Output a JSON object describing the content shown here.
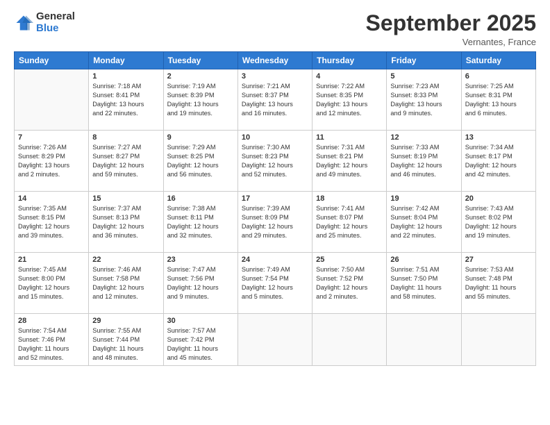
{
  "logo": {
    "general": "General",
    "blue": "Blue"
  },
  "header": {
    "title": "September 2025",
    "location": "Vernantes, France"
  },
  "weekdays": [
    "Sunday",
    "Monday",
    "Tuesday",
    "Wednesday",
    "Thursday",
    "Friday",
    "Saturday"
  ],
  "weeks": [
    [
      {
        "day": "",
        "info": ""
      },
      {
        "day": "1",
        "info": "Sunrise: 7:18 AM\nSunset: 8:41 PM\nDaylight: 13 hours\nand 22 minutes."
      },
      {
        "day": "2",
        "info": "Sunrise: 7:19 AM\nSunset: 8:39 PM\nDaylight: 13 hours\nand 19 minutes."
      },
      {
        "day": "3",
        "info": "Sunrise: 7:21 AM\nSunset: 8:37 PM\nDaylight: 13 hours\nand 16 minutes."
      },
      {
        "day": "4",
        "info": "Sunrise: 7:22 AM\nSunset: 8:35 PM\nDaylight: 13 hours\nand 12 minutes."
      },
      {
        "day": "5",
        "info": "Sunrise: 7:23 AM\nSunset: 8:33 PM\nDaylight: 13 hours\nand 9 minutes."
      },
      {
        "day": "6",
        "info": "Sunrise: 7:25 AM\nSunset: 8:31 PM\nDaylight: 13 hours\nand 6 minutes."
      }
    ],
    [
      {
        "day": "7",
        "info": "Sunrise: 7:26 AM\nSunset: 8:29 PM\nDaylight: 13 hours\nand 2 minutes."
      },
      {
        "day": "8",
        "info": "Sunrise: 7:27 AM\nSunset: 8:27 PM\nDaylight: 12 hours\nand 59 minutes."
      },
      {
        "day": "9",
        "info": "Sunrise: 7:29 AM\nSunset: 8:25 PM\nDaylight: 12 hours\nand 56 minutes."
      },
      {
        "day": "10",
        "info": "Sunrise: 7:30 AM\nSunset: 8:23 PM\nDaylight: 12 hours\nand 52 minutes."
      },
      {
        "day": "11",
        "info": "Sunrise: 7:31 AM\nSunset: 8:21 PM\nDaylight: 12 hours\nand 49 minutes."
      },
      {
        "day": "12",
        "info": "Sunrise: 7:33 AM\nSunset: 8:19 PM\nDaylight: 12 hours\nand 46 minutes."
      },
      {
        "day": "13",
        "info": "Sunrise: 7:34 AM\nSunset: 8:17 PM\nDaylight: 12 hours\nand 42 minutes."
      }
    ],
    [
      {
        "day": "14",
        "info": "Sunrise: 7:35 AM\nSunset: 8:15 PM\nDaylight: 12 hours\nand 39 minutes."
      },
      {
        "day": "15",
        "info": "Sunrise: 7:37 AM\nSunset: 8:13 PM\nDaylight: 12 hours\nand 36 minutes."
      },
      {
        "day": "16",
        "info": "Sunrise: 7:38 AM\nSunset: 8:11 PM\nDaylight: 12 hours\nand 32 minutes."
      },
      {
        "day": "17",
        "info": "Sunrise: 7:39 AM\nSunset: 8:09 PM\nDaylight: 12 hours\nand 29 minutes."
      },
      {
        "day": "18",
        "info": "Sunrise: 7:41 AM\nSunset: 8:07 PM\nDaylight: 12 hours\nand 25 minutes."
      },
      {
        "day": "19",
        "info": "Sunrise: 7:42 AM\nSunset: 8:04 PM\nDaylight: 12 hours\nand 22 minutes."
      },
      {
        "day": "20",
        "info": "Sunrise: 7:43 AM\nSunset: 8:02 PM\nDaylight: 12 hours\nand 19 minutes."
      }
    ],
    [
      {
        "day": "21",
        "info": "Sunrise: 7:45 AM\nSunset: 8:00 PM\nDaylight: 12 hours\nand 15 minutes."
      },
      {
        "day": "22",
        "info": "Sunrise: 7:46 AM\nSunset: 7:58 PM\nDaylight: 12 hours\nand 12 minutes."
      },
      {
        "day": "23",
        "info": "Sunrise: 7:47 AM\nSunset: 7:56 PM\nDaylight: 12 hours\nand 9 minutes."
      },
      {
        "day": "24",
        "info": "Sunrise: 7:49 AM\nSunset: 7:54 PM\nDaylight: 12 hours\nand 5 minutes."
      },
      {
        "day": "25",
        "info": "Sunrise: 7:50 AM\nSunset: 7:52 PM\nDaylight: 12 hours\nand 2 minutes."
      },
      {
        "day": "26",
        "info": "Sunrise: 7:51 AM\nSunset: 7:50 PM\nDaylight: 11 hours\nand 58 minutes."
      },
      {
        "day": "27",
        "info": "Sunrise: 7:53 AM\nSunset: 7:48 PM\nDaylight: 11 hours\nand 55 minutes."
      }
    ],
    [
      {
        "day": "28",
        "info": "Sunrise: 7:54 AM\nSunset: 7:46 PM\nDaylight: 11 hours\nand 52 minutes."
      },
      {
        "day": "29",
        "info": "Sunrise: 7:55 AM\nSunset: 7:44 PM\nDaylight: 11 hours\nand 48 minutes."
      },
      {
        "day": "30",
        "info": "Sunrise: 7:57 AM\nSunset: 7:42 PM\nDaylight: 11 hours\nand 45 minutes."
      },
      {
        "day": "",
        "info": ""
      },
      {
        "day": "",
        "info": ""
      },
      {
        "day": "",
        "info": ""
      },
      {
        "day": "",
        "info": ""
      }
    ]
  ]
}
